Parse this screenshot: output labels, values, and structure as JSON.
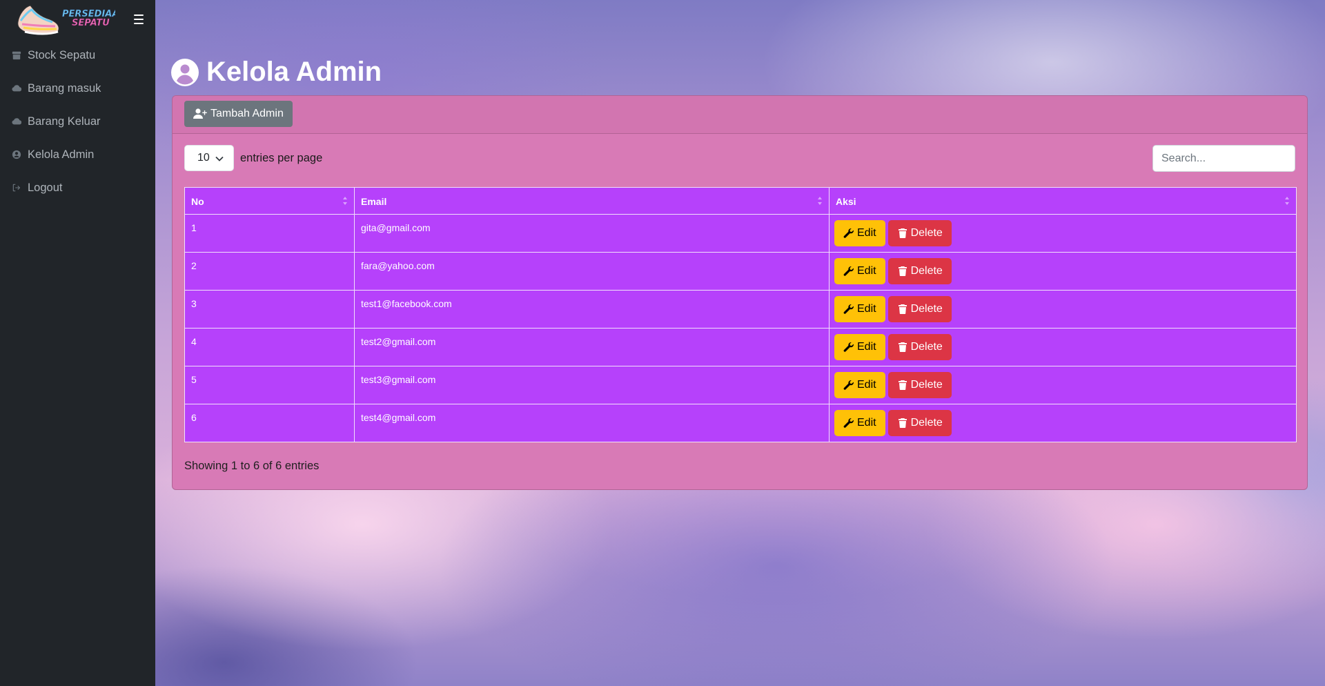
{
  "brand": {
    "logo_line1": "PERSEDIAAN",
    "logo_line2": "SEPATU"
  },
  "sidebar": {
    "items": [
      {
        "label": "Stock Sepatu",
        "icon": "archive-icon"
      },
      {
        "label": "Barang masuk",
        "icon": "cloud-download-icon"
      },
      {
        "label": "Barang Keluar",
        "icon": "cloud-upload-icon"
      },
      {
        "label": "Kelola Admin",
        "icon": "user-circle-icon"
      },
      {
        "label": "Logout",
        "icon": "logout-icon"
      }
    ]
  },
  "page": {
    "title": "Kelola Admin"
  },
  "toolbar": {
    "add_label": "Tambah Admin"
  },
  "table_controls": {
    "per_page_value": "10",
    "per_page_label": "entries per page",
    "search_placeholder": "Search..."
  },
  "table": {
    "columns": [
      "No",
      "Email",
      "Aksi"
    ],
    "rows": [
      {
        "no": "1",
        "email": "gita@gmail.com"
      },
      {
        "no": "2",
        "email": "fara@yahoo.com"
      },
      {
        "no": "3",
        "email": "test1@facebook.com"
      },
      {
        "no": "4",
        "email": "test2@gmail.com"
      },
      {
        "no": "5",
        "email": "test3@gmail.com"
      },
      {
        "no": "6",
        "email": "test4@gmail.com"
      }
    ],
    "edit_label": "Edit",
    "delete_label": "Delete",
    "info": "Showing 1 to 6 of 6 entries"
  },
  "colors": {
    "sidebar_bg": "#212529",
    "card_bg": "#d87ab6",
    "table_bg": "#b641fb",
    "edit_btn": "#ffc107",
    "delete_btn": "#dc3545",
    "add_btn": "#6c757d"
  }
}
